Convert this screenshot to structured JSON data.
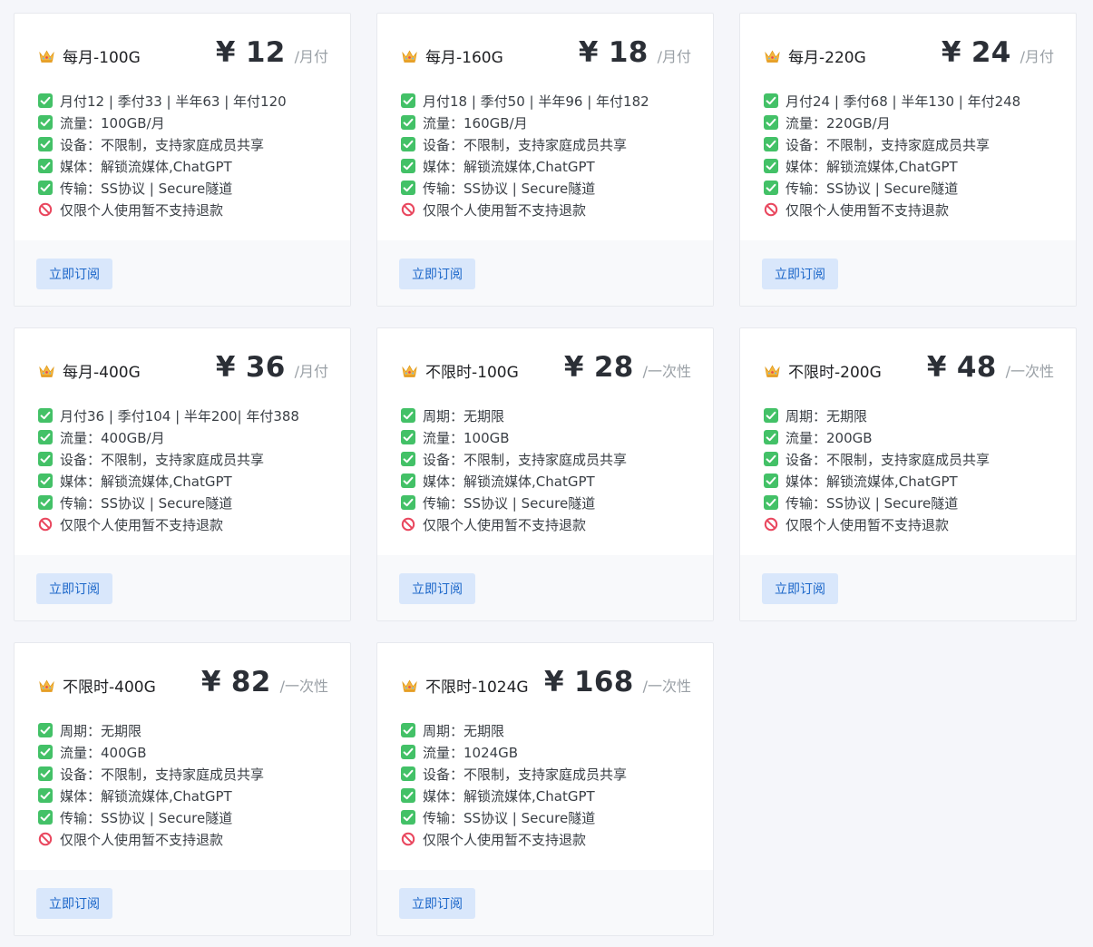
{
  "plans": [
    {
      "name": "每月-100G",
      "price": "¥ 12",
      "period": "/月付",
      "button": "立即订阅",
      "features": [
        {
          "icon": "check",
          "text": "月付12 | 季付33 | 半年63 | 年付120"
        },
        {
          "icon": "check",
          "text": "流量：100GB/月"
        },
        {
          "icon": "check",
          "text": "设备：不限制，支持家庭成员共享"
        },
        {
          "icon": "check",
          "text": "媒体：解锁流媒体,ChatGPT"
        },
        {
          "icon": "check",
          "text": "传输：SS协议 | Secure隧道"
        },
        {
          "icon": "prohibited",
          "text": "仅限个人使用暂不支持退款"
        }
      ]
    },
    {
      "name": "每月-160G",
      "price": "¥ 18",
      "period": "/月付",
      "button": "立即订阅",
      "features": [
        {
          "icon": "check",
          "text": "月付18 | 季付50 | 半年96 | 年付182"
        },
        {
          "icon": "check",
          "text": "流量：160GB/月"
        },
        {
          "icon": "check",
          "text": "设备：不限制，支持家庭成员共享"
        },
        {
          "icon": "check",
          "text": "媒体：解锁流媒体,ChatGPT"
        },
        {
          "icon": "check",
          "text": "传输：SS协议 | Secure隧道"
        },
        {
          "icon": "prohibited",
          "text": "仅限个人使用暂不支持退款"
        }
      ]
    },
    {
      "name": "每月-220G",
      "price": "¥ 24",
      "period": "/月付",
      "button": "立即订阅",
      "features": [
        {
          "icon": "check",
          "text": "月付24 | 季付68 | 半年130 | 年付248"
        },
        {
          "icon": "check",
          "text": "流量：220GB/月"
        },
        {
          "icon": "check",
          "text": "设备：不限制，支持家庭成员共享"
        },
        {
          "icon": "check",
          "text": "媒体：解锁流媒体,ChatGPT"
        },
        {
          "icon": "check",
          "text": "传输：SS协议 | Secure隧道"
        },
        {
          "icon": "prohibited",
          "text": "仅限个人使用暂不支持退款"
        }
      ]
    },
    {
      "name": "每月-400G",
      "price": "¥ 36",
      "period": "/月付",
      "button": "立即订阅",
      "features": [
        {
          "icon": "check",
          "text": "月付36 | 季付104 | 半年200| 年付388"
        },
        {
          "icon": "check",
          "text": "流量：400GB/月"
        },
        {
          "icon": "check",
          "text": "设备：不限制，支持家庭成员共享"
        },
        {
          "icon": "check",
          "text": "媒体：解锁流媒体,ChatGPT"
        },
        {
          "icon": "check",
          "text": "传输：SS协议 | Secure隧道"
        },
        {
          "icon": "prohibited",
          "text": "仅限个人使用暂不支持退款"
        }
      ]
    },
    {
      "name": "不限时-100G",
      "price": "¥ 28",
      "period": "/一次性",
      "button": "立即订阅",
      "features": [
        {
          "icon": "check",
          "text": "周期：无期限"
        },
        {
          "icon": "check",
          "text": "流量：100GB"
        },
        {
          "icon": "check",
          "text": "设备：不限制，支持家庭成员共享"
        },
        {
          "icon": "check",
          "text": "媒体：解锁流媒体,ChatGPT"
        },
        {
          "icon": "check",
          "text": "传输：SS协议 | Secure隧道"
        },
        {
          "icon": "prohibited",
          "text": "仅限个人使用暂不支持退款"
        }
      ]
    },
    {
      "name": "不限时-200G",
      "price": "¥ 48",
      "period": "/一次性",
      "button": "立即订阅",
      "features": [
        {
          "icon": "check",
          "text": "周期：无期限"
        },
        {
          "icon": "check",
          "text": "流量：200GB"
        },
        {
          "icon": "check",
          "text": "设备：不限制，支持家庭成员共享"
        },
        {
          "icon": "check",
          "text": "媒体：解锁流媒体,ChatGPT"
        },
        {
          "icon": "check",
          "text": "传输：SS协议 | Secure隧道"
        },
        {
          "icon": "prohibited",
          "text": "仅限个人使用暂不支持退款"
        }
      ]
    },
    {
      "name": "不限时-400G",
      "price": "¥ 82",
      "period": "/一次性",
      "button": "立即订阅",
      "features": [
        {
          "icon": "check",
          "text": "周期：无期限"
        },
        {
          "icon": "check",
          "text": "流量：400GB"
        },
        {
          "icon": "check",
          "text": "设备：不限制，支持家庭成员共享"
        },
        {
          "icon": "check",
          "text": "媒体：解锁流媒体,ChatGPT"
        },
        {
          "icon": "check",
          "text": "传输：SS协议 | Secure隧道"
        },
        {
          "icon": "prohibited",
          "text": "仅限个人使用暂不支持退款"
        }
      ]
    },
    {
      "name": "不限时-1024G",
      "price": "¥ 168",
      "period": "/一次性",
      "button": "立即订阅",
      "features": [
        {
          "icon": "check",
          "text": "周期：无期限"
        },
        {
          "icon": "check",
          "text": "流量：1024GB"
        },
        {
          "icon": "check",
          "text": "设备：不限制，支持家庭成员共享"
        },
        {
          "icon": "check",
          "text": "媒体：解锁流媒体,ChatGPT"
        },
        {
          "icon": "check",
          "text": "传输：SS协议 | Secure隧道"
        },
        {
          "icon": "prohibited",
          "text": "仅限个人使用暂不支持退款"
        }
      ]
    }
  ],
  "colors": {
    "check": "#43c167",
    "prohibited": "#e9475e",
    "button_bg": "#d9e7fb",
    "button_text": "#1a66c9",
    "crown": "#f4b63f"
  }
}
